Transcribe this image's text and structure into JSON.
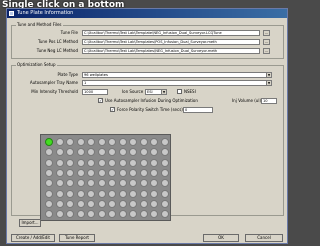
{
  "caption": "Single click on a bottom",
  "window": {
    "title": "Tune Plate Information"
  },
  "tune_group": {
    "title": "Tune and Method Files",
    "tune_file_label": "Tune File",
    "tune_file_value": "C:\\Xcalibur\\Thermo\\Test Lab\\Template\\NEG_Infusion_Dual_Surveyor.LCQTune",
    "tune_pos_label": "Tune Pos LC Method",
    "tune_pos_value": "C:\\Xcalibur\\Thermo\\Test Lab\\Templates\\POS_Infusion_Dual_Surveyor.meth",
    "tune_neg_label": "Tune Neg LC Method",
    "tune_neg_value": "C:\\Xcalibur\\Thermo\\Test Lab\\Templates\\NEG_Infusion_Dual_Surveyor.meth",
    "browse": "..."
  },
  "opt_group": {
    "title": "Optimization Setup",
    "plate_type_label": "Plate Type",
    "plate_type_value": "96 wellplates",
    "tray_label": "Autosampler Tray Name",
    "tray_value": "1",
    "intensity_label": "Min Intensity Threshold",
    "intensity_value": "1000",
    "ion_source_label": "Ion Source",
    "ion_source_value": "ESI",
    "nsesi_label": "NSESI",
    "infusion_label": "Use Autosampler Infusion During Optimization",
    "inj_vol_label": "Inj Volume (ul)",
    "inj_vol_value": "10",
    "polarity_label": "Force Polarity Switch Time (secs)",
    "polarity_value": "0"
  },
  "buttons": {
    "import": "Import...",
    "create": "Create / Add/Edit",
    "tune_report": "Tune Report",
    "ok": "OK",
    "cancel": "Cancel"
  }
}
